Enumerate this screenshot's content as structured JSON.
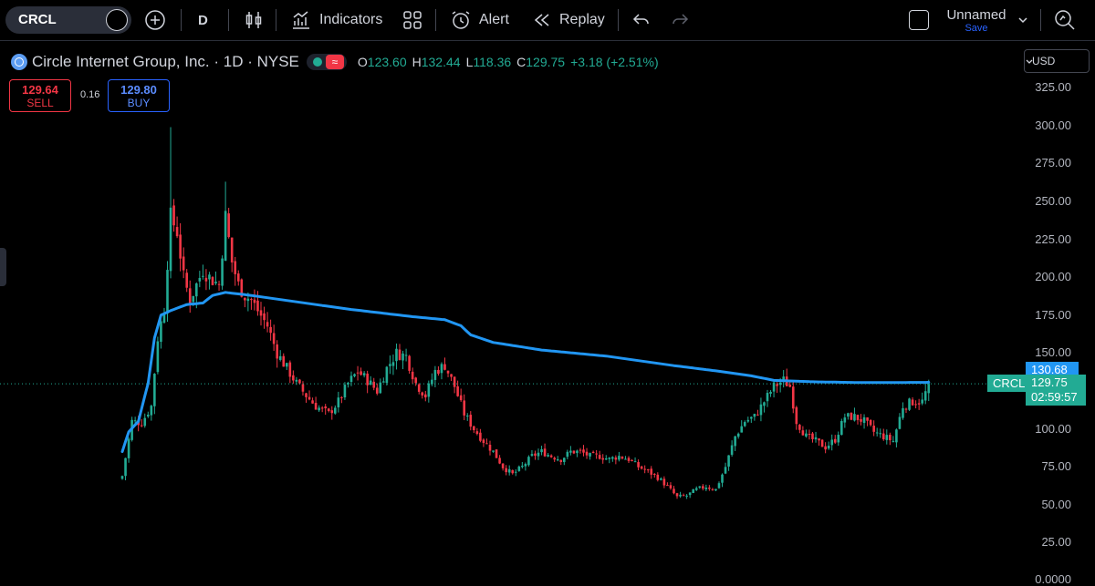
{
  "toolbar": {
    "symbol": "CRCL",
    "interval": "D",
    "indicators_label": "Indicators",
    "alert_label": "Alert",
    "replay_label": "Replay",
    "layout_name": "Unnamed",
    "save_label": "Save"
  },
  "legend": {
    "title": "Circle Internet Group, Inc. · 1D · NYSE",
    "o_key": "O",
    "o_val": "123.60",
    "h_key": "H",
    "h_val": "132.44",
    "l_key": "L",
    "l_val": "118.36",
    "c_key": "C",
    "c_val": "129.75",
    "change": "+3.18 (+2.51%)"
  },
  "trade": {
    "sell_price": "129.64",
    "sell_label": "SELL",
    "spread": "0.16",
    "buy_price": "129.80",
    "buy_label": "BUY"
  },
  "currency": "USD",
  "colors": {
    "up": "#22ab94",
    "down": "#f23645",
    "ma": "#2196f3",
    "buy": "#2962ff"
  },
  "price_tags": {
    "ma_value": "130.68",
    "symbol": "CRCL",
    "last_price": "129.75",
    "countdown": "02:59:57"
  },
  "chart_data": {
    "type": "candlestick",
    "y_ticks": [
      "325.00",
      "300.00",
      "275.00",
      "250.00",
      "225.00",
      "200.00",
      "175.00",
      "150.00",
      "100.00",
      "75.00",
      "50.00",
      "25.00",
      "0.0000"
    ],
    "y_tick_values": [
      325,
      300,
      275,
      250,
      225,
      200,
      175,
      150,
      100,
      75,
      50,
      25,
      0
    ],
    "ylim": [
      0,
      325
    ],
    "grid": false,
    "last_price_line": 129.75,
    "close_anchors": [
      [
        0,
        69
      ],
      [
        3,
        105
      ],
      [
        6,
        104
      ],
      [
        9,
        115
      ],
      [
        11,
        160
      ],
      [
        13,
        180
      ],
      [
        15,
        240
      ],
      [
        17,
        230
      ],
      [
        19,
        200
      ],
      [
        21,
        185
      ],
      [
        23,
        195
      ],
      [
        25,
        205
      ],
      [
        27,
        200
      ],
      [
        30,
        195
      ],
      [
        32,
        240
      ],
      [
        34,
        210
      ],
      [
        36,
        195
      ],
      [
        38,
        188
      ],
      [
        40,
        185
      ],
      [
        42,
        178
      ],
      [
        45,
        168
      ],
      [
        48,
        150
      ],
      [
        51,
        140
      ],
      [
        54,
        130
      ],
      [
        57,
        122
      ],
      [
        60,
        115
      ],
      [
        64,
        110
      ],
      [
        67,
        118
      ],
      [
        70,
        130
      ],
      [
        73,
        138
      ],
      [
        76,
        132
      ],
      [
        79,
        125
      ],
      [
        82,
        140
      ],
      [
        85,
        150
      ],
      [
        88,
        148
      ],
      [
        91,
        130
      ],
      [
        94,
        122
      ],
      [
        97,
        138
      ],
      [
        100,
        142
      ],
      [
        103,
        128
      ],
      [
        106,
        110
      ],
      [
        109,
        100
      ],
      [
        112,
        92
      ],
      [
        115,
        85
      ],
      [
        118,
        75
      ],
      [
        121,
        70
      ],
      [
        124,
        75
      ],
      [
        127,
        82
      ],
      [
        130,
        85
      ],
      [
        133,
        82
      ],
      [
        136,
        80
      ],
      [
        139,
        85
      ],
      [
        142,
        85
      ],
      [
        145,
        82
      ],
      [
        148,
        82
      ],
      [
        151,
        80
      ],
      [
        154,
        82
      ],
      [
        157,
        80
      ],
      [
        160,
        75
      ],
      [
        163,
        72
      ],
      [
        166,
        68
      ],
      [
        169,
        62
      ],
      [
        172,
        55
      ],
      [
        175,
        56
      ],
      [
        178,
        60
      ],
      [
        181,
        62
      ],
      [
        184,
        60
      ],
      [
        187,
        75
      ],
      [
        190,
        95
      ],
      [
        193,
        105
      ],
      [
        196,
        108
      ],
      [
        199,
        118
      ],
      [
        202,
        128
      ],
      [
        205,
        132
      ],
      [
        207,
        128
      ],
      [
        209,
        105
      ],
      [
        212,
        95
      ],
      [
        215,
        92
      ],
      [
        218,
        88
      ],
      [
        221,
        93
      ],
      [
        224,
        108
      ],
      [
        227,
        108
      ],
      [
        230,
        105
      ],
      [
        233,
        98
      ],
      [
        236,
        95
      ],
      [
        239,
        92
      ],
      [
        242,
        115
      ],
      [
        245,
        118
      ],
      [
        248,
        118
      ],
      [
        250,
        129.75
      ]
    ],
    "ma_anchors": [
      [
        0,
        85
      ],
      [
        2,
        98
      ],
      [
        5,
        105
      ],
      [
        8,
        130
      ],
      [
        10,
        160
      ],
      [
        12,
        175
      ],
      [
        15,
        178
      ],
      [
        20,
        182
      ],
      [
        25,
        183
      ],
      [
        28,
        188
      ],
      [
        32,
        190
      ],
      [
        40,
        188
      ],
      [
        50,
        185
      ],
      [
        70,
        179
      ],
      [
        90,
        174
      ],
      [
        100,
        172
      ],
      [
        105,
        168
      ],
      [
        108,
        162
      ],
      [
        115,
        157
      ],
      [
        130,
        152
      ],
      [
        150,
        148
      ],
      [
        170,
        142
      ],
      [
        185,
        138
      ],
      [
        195,
        135
      ],
      [
        202,
        132
      ],
      [
        215,
        131
      ],
      [
        230,
        130.5
      ],
      [
        250,
        130.68
      ]
    ],
    "bar_count": 251
  }
}
